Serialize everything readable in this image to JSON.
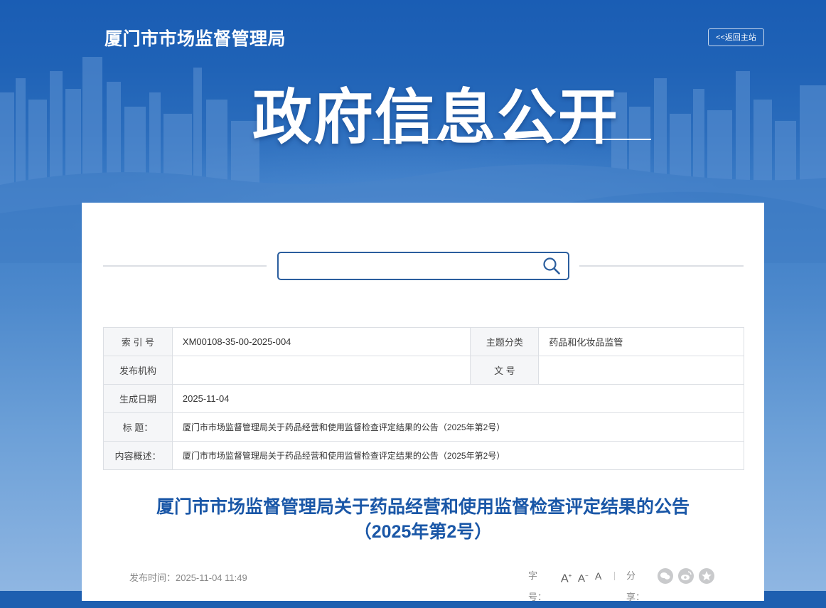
{
  "header": {
    "site_title": "厦门市市场监督管理局",
    "back_link": "<<返回主站",
    "hero_title": "政府信息公开"
  },
  "search": {
    "placeholder": "",
    "icon": "search-icon"
  },
  "meta_table": {
    "index_label": "索 引 号",
    "index_value": "XM00108-35-00-2025-004",
    "topic_label": "主题分类",
    "topic_value": "药品和化妆品监管",
    "issuer_label": "发布机构",
    "issuer_value": "",
    "docno_label": "文 号",
    "docno_value": "",
    "date_label": "生成日期",
    "date_value": "2025-11-04",
    "title_label": "标 题：",
    "title_value": "厦门市市场监督管理局关于药品经营和使用监督检查评定结果的公告（2025年第2号）",
    "summary_label": "内容概述：",
    "summary_value": "厦门市市场监督管理局关于药品经营和使用监督检查评定结果的公告（2025年第2号）"
  },
  "document": {
    "title_line1": "厦门市市场监督管理局关于药品经营和使用监督检查评定结果的公告",
    "title_line2": "（2025年第2号）",
    "publish_time": "发布时间：2025-11-04 11:49"
  },
  "tools": {
    "font_size_label": "字号：",
    "font_large": "A",
    "font_medium": "A",
    "font_small": "A",
    "share_label": "分享：",
    "share_icons": [
      "wechat-icon",
      "weibo-icon",
      "favorite-icon"
    ]
  },
  "colors": {
    "brand_blue": "#1a57a7",
    "border": "#dcdfe4",
    "label_bg": "#f5f6f8"
  }
}
